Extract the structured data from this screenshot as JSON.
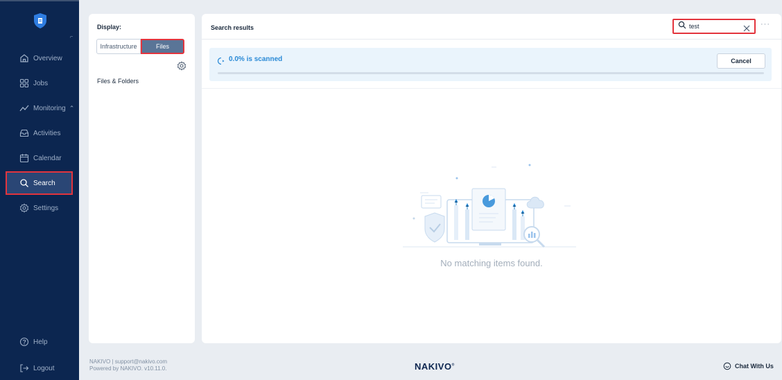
{
  "sidebar": {
    "items": [
      {
        "label": "Overview",
        "icon": "home-icon"
      },
      {
        "label": "Jobs",
        "icon": "grid-icon"
      },
      {
        "label": "Monitoring",
        "icon": "trend-icon"
      },
      {
        "label": "Activities",
        "icon": "inbox-icon"
      },
      {
        "label": "Calendar",
        "icon": "calendar-icon"
      },
      {
        "label": "Search",
        "icon": "search-icon"
      },
      {
        "label": "Settings",
        "icon": "gear-icon"
      }
    ],
    "help": "Help",
    "logout": "Logout"
  },
  "display": {
    "title": "Display:",
    "tabs": [
      "Infrastructure",
      "Files"
    ],
    "active_tab": "Files",
    "section": "Files & Folders"
  },
  "results": {
    "title": "Search results",
    "search_value": "test",
    "scan_text": "0.0% is scanned",
    "scan_progress": 0.0,
    "cancel": "Cancel",
    "empty": "No matching items found."
  },
  "footer": {
    "line1": "NAKIVO | support@nakivo.com",
    "line2": "Powered by NAKIVO. v10.11.0.",
    "brand": "NAKIVO",
    "chat": "Chat With Us"
  },
  "colors": {
    "sidebar": "#0c2650",
    "accent": "#2a8ad6",
    "highlight": "#e3343d"
  }
}
